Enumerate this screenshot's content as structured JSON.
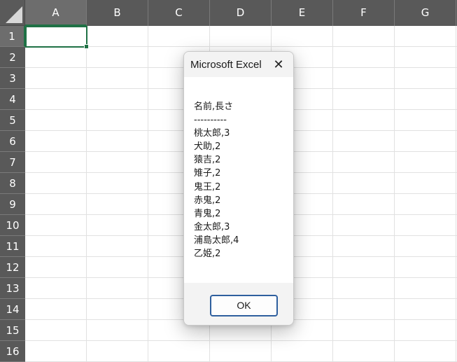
{
  "sheet": {
    "columns": [
      "A",
      "B",
      "C",
      "D",
      "E",
      "F",
      "G"
    ],
    "rows": [
      "1",
      "2",
      "3",
      "4",
      "5",
      "6",
      "7",
      "8",
      "9",
      "10",
      "11",
      "12",
      "13",
      "14",
      "15",
      "16"
    ],
    "selected_column": "A",
    "selected_row": "1",
    "active_cell_value": ""
  },
  "dialog": {
    "title": "Microsoft Excel",
    "close_glyph": "✕",
    "message_lines": [
      "名前,長さ",
      "----------",
      "桃太郎,3",
      "犬助,2",
      "猿吉,2",
      "雉子,2",
      "鬼王,2",
      "赤鬼,2",
      "青鬼,2",
      "金太郎,3",
      "浦島太郎,4",
      "乙姫,2"
    ],
    "ok_label": "OK"
  },
  "colors": {
    "header_bg": "#595959",
    "header_selected_bg": "#6d6d6d",
    "accent_green": "#1f7145",
    "dialog_bg": "#f3f3f3",
    "ok_border": "#2e5f9e"
  }
}
